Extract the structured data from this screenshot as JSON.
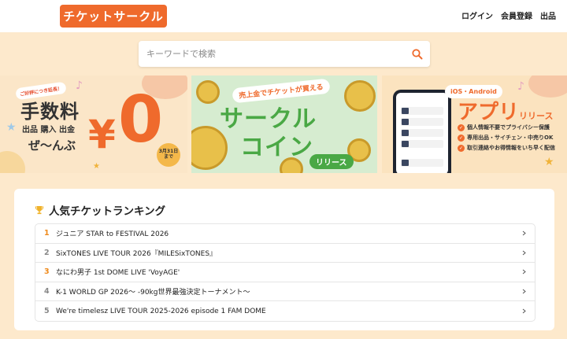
{
  "header": {
    "logo_text": "チケットサークル",
    "nav": [
      "ログイン",
      "会員登録",
      "出品"
    ]
  },
  "search": {
    "placeholder": "キーワードで検索"
  },
  "banners": [
    {
      "tag": "ご好評につき延長！",
      "title": "手数料",
      "sub": "出品 購入 出金",
      "sub2": "ぜ〜んぶ",
      "yen": "¥",
      "zero": "0",
      "date_line1": "3月31日",
      "date_line2": "まで"
    },
    {
      "top": "売上金でチケットが買える",
      "line1": "サークル",
      "line2": "コイン",
      "release": "リリース"
    },
    {
      "ios": "iOS・Android",
      "app": "アプリ",
      "app_suffix": "リリース",
      "features": [
        "個人情報不要でプライバシー保護",
        "専用出品・サイチェン・中売りOK",
        "取引連絡やお得情報をいち早く配信"
      ]
    }
  ],
  "ranking": {
    "title": "人気チケットランキング",
    "items": [
      {
        "rank": "1",
        "name": "ジュニア STAR to FESTIVAL 2026"
      },
      {
        "rank": "2",
        "name": "SixTONES LIVE TOUR 2026『MILESixTONES』"
      },
      {
        "rank": "3",
        "name": "なにわ男子 1st DOME LIVE 'VoyAGE'"
      },
      {
        "rank": "4",
        "name": "K-1 WORLD GP 2026〜 -90kg世界最強決定トーナメント〜"
      },
      {
        "rank": "5",
        "name": "We're timelesz LIVE TOUR 2025-2026 episode 1 FAM DOME"
      }
    ]
  },
  "colors": {
    "brand": "#ef6a2c",
    "page_bg": "#fde9cc",
    "coin_green": "#4aa845",
    "rank_top": "#ef8a1c"
  }
}
